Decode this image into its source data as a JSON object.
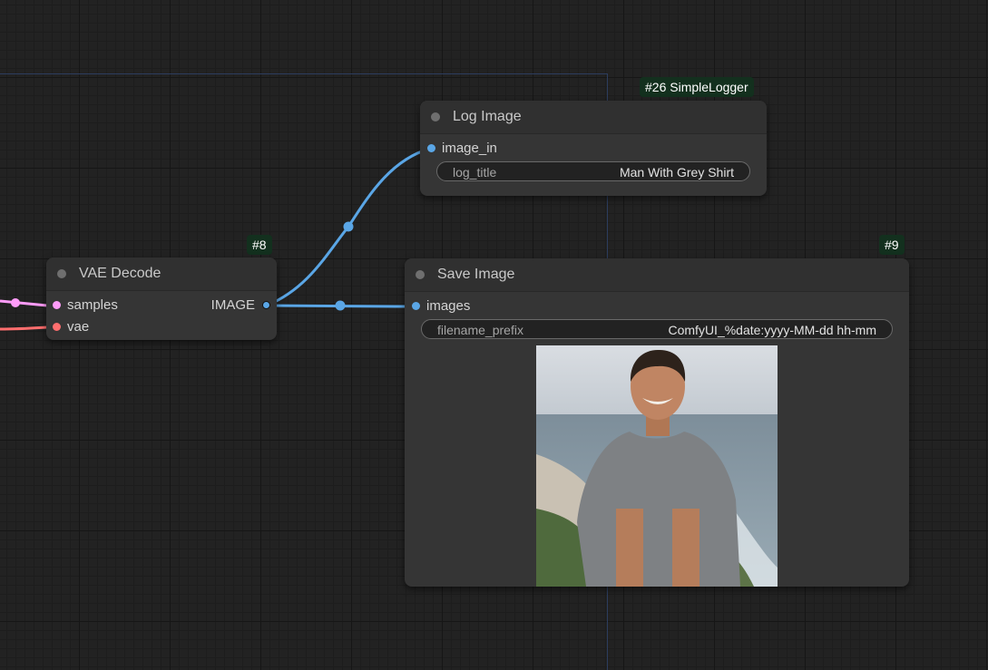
{
  "colors": {
    "image_link": "#5aa6e6",
    "latent_link": "#ff9cf9",
    "vae_link": "#ff6e6e"
  },
  "nodes": {
    "log_image": {
      "badge": "#26 SimpleLogger",
      "title": "Log Image",
      "input": "image_in",
      "widget": {
        "name": "log_title",
        "value": "Man With Grey Shirt"
      }
    },
    "vae_decode": {
      "badge": "#8",
      "title": "VAE Decode",
      "inputs": [
        "samples",
        "vae"
      ],
      "output": "IMAGE"
    },
    "save_image": {
      "badge": "#9",
      "title": "Save Image",
      "input": "images",
      "widget": {
        "name": "filename_prefix",
        "value": "ComfyUI_%date:yyyy-MM-dd hh-mm"
      },
      "preview": "generated-image-preview"
    }
  }
}
